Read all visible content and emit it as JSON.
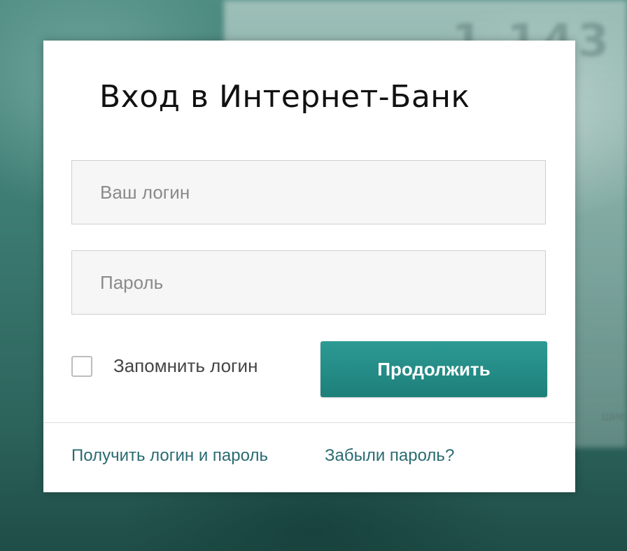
{
  "login_form": {
    "title": "Вход в Интернет-Банк",
    "login_placeholder": "Ваш логин",
    "password_placeholder": "Пароль",
    "remember_label": "Запомнить логин",
    "submit_label": "Продолжить",
    "get_credentials_link": "Получить логин и пароль",
    "forgot_password_link": "Забыли пароль?"
  },
  "colors": {
    "accent": "#1f8580",
    "link": "#2a6b71",
    "background": "#3c7b72"
  }
}
